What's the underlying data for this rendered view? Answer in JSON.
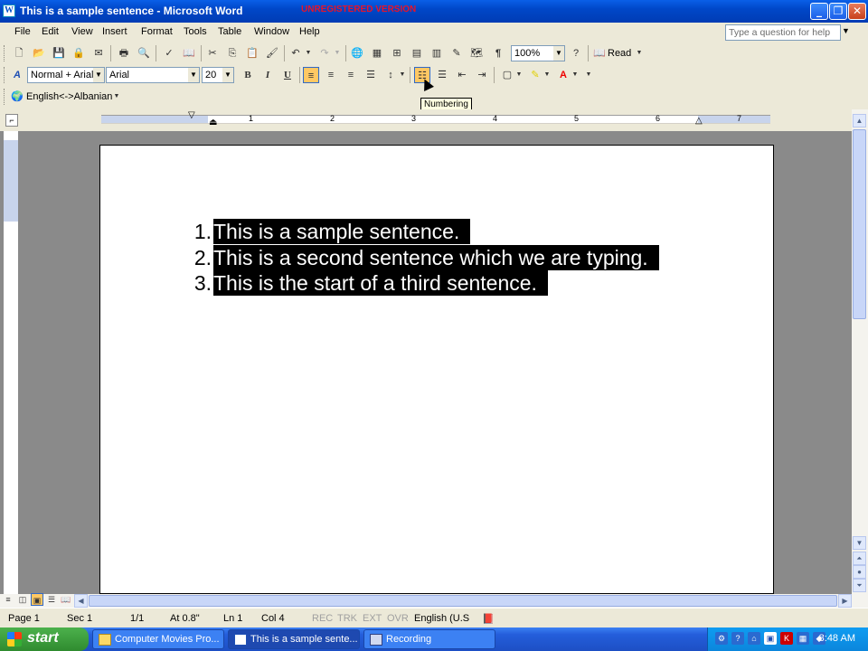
{
  "window": {
    "title": "This is a sample sentence - Microsoft Word",
    "watermark": "UNREGISTERED VERSION"
  },
  "menu": {
    "items": [
      "File",
      "Edit",
      "View",
      "Insert",
      "Format",
      "Tools",
      "Table",
      "Window",
      "Help"
    ],
    "help_placeholder": "Type a question for help"
  },
  "standard_toolbar": {
    "zoom": "100%",
    "read_label": "Read"
  },
  "formatting_toolbar": {
    "style": "Normal + Arial,",
    "font": "Arial",
    "size": "20",
    "bold": "B",
    "italic": "I",
    "underline": "U"
  },
  "translate_toolbar": {
    "label": "English<->Albanian"
  },
  "tooltip": "Numbering",
  "document": {
    "items": [
      {
        "num": "1.",
        "text": "This is a sample sentence."
      },
      {
        "num": "2.",
        "text": "This is a second sentence which we are typing."
      },
      {
        "num": "3.",
        "text": "This is the start of a third sentence."
      }
    ]
  },
  "ruler": {
    "numbers": [
      "1",
      "2",
      "3",
      "4",
      "5",
      "6",
      "7"
    ]
  },
  "statusbar": {
    "page": "Page 1",
    "sec": "Sec 1",
    "pages": "1/1",
    "at": "At 0.8\"",
    "ln": "Ln 1",
    "col": "Col 4",
    "rec": "REC",
    "trk": "TRK",
    "ext": "EXT",
    "ovr": "OVR",
    "lang": "English (U.S"
  },
  "taskbar": {
    "start": "start",
    "tasks": [
      "Computer Movies Pro...",
      "This is a sample sente...",
      "Recording"
    ],
    "clock": "8:48 AM"
  }
}
